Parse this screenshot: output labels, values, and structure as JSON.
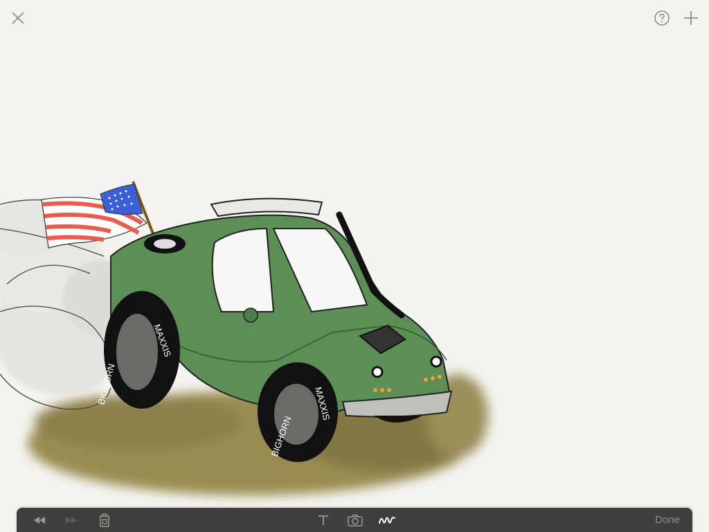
{
  "toolbar": {
    "done_label": "Done"
  },
  "icons": {
    "close": "close-icon",
    "help": "help-icon",
    "add": "plus-icon",
    "rewind": "rewind-icon",
    "fast_forward": "fast-forward-icon",
    "clear": "clear-canvas-icon",
    "text": "text-tool-icon",
    "camera": "camera-icon",
    "draw": "draw-tool-icon"
  },
  "colors": {
    "canvas_bg": "#f4f3ef",
    "toolbar_bg": "#3f3f3d",
    "icon_grey": "#8d8d89",
    "active_tool": "#ffffff"
  },
  "drawing": {
    "tire_text_1": "BIGHORN",
    "tire_text_2": "MAXXIS"
  }
}
